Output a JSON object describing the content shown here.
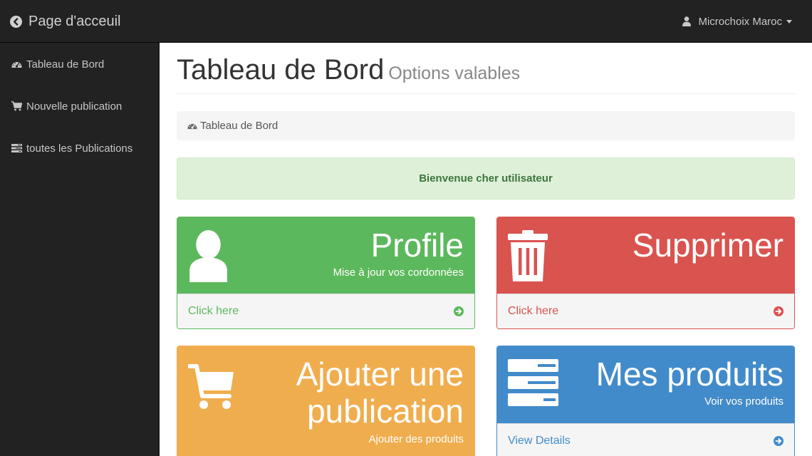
{
  "navbar": {
    "brand_label": "Page d'acceuil",
    "user_name": "Microchoix Maroc"
  },
  "sidebar": {
    "items": [
      {
        "label": "Tableau de Bord",
        "icon": "dashboard-icon"
      },
      {
        "label": "Nouvelle publication",
        "icon": "cart-icon"
      },
      {
        "label": "toutes les Publications",
        "icon": "tasks-icon"
      }
    ]
  },
  "page": {
    "title": "Tableau de Bord",
    "subtitle": "Options valables"
  },
  "breadcrumb": {
    "label": "Tableau de Bord",
    "icon": "dashboard-icon"
  },
  "alert": {
    "message": "Bienvenue cher utilisateur"
  },
  "panels": {
    "profile": {
      "title": "Profile",
      "subtitle": "Mise à jour vos cordonnées",
      "footer": "Click here",
      "icon": "user-icon",
      "color": "#5cb85c"
    },
    "delete": {
      "title": "Supprimer",
      "footer": "Click here",
      "icon": "trash-icon",
      "color": "#d9534f"
    },
    "add": {
      "title_line1": "Ajouter une",
      "title_line2": "publication",
      "subtitle": "Ajouter des produits",
      "icon": "shopping-cart-icon",
      "color": "#f0ad4e"
    },
    "products": {
      "title": "Mes produits",
      "subtitle": "Voir vos produits",
      "footer": "View Details",
      "icon": "tasks-icon",
      "color": "#428bca"
    }
  }
}
